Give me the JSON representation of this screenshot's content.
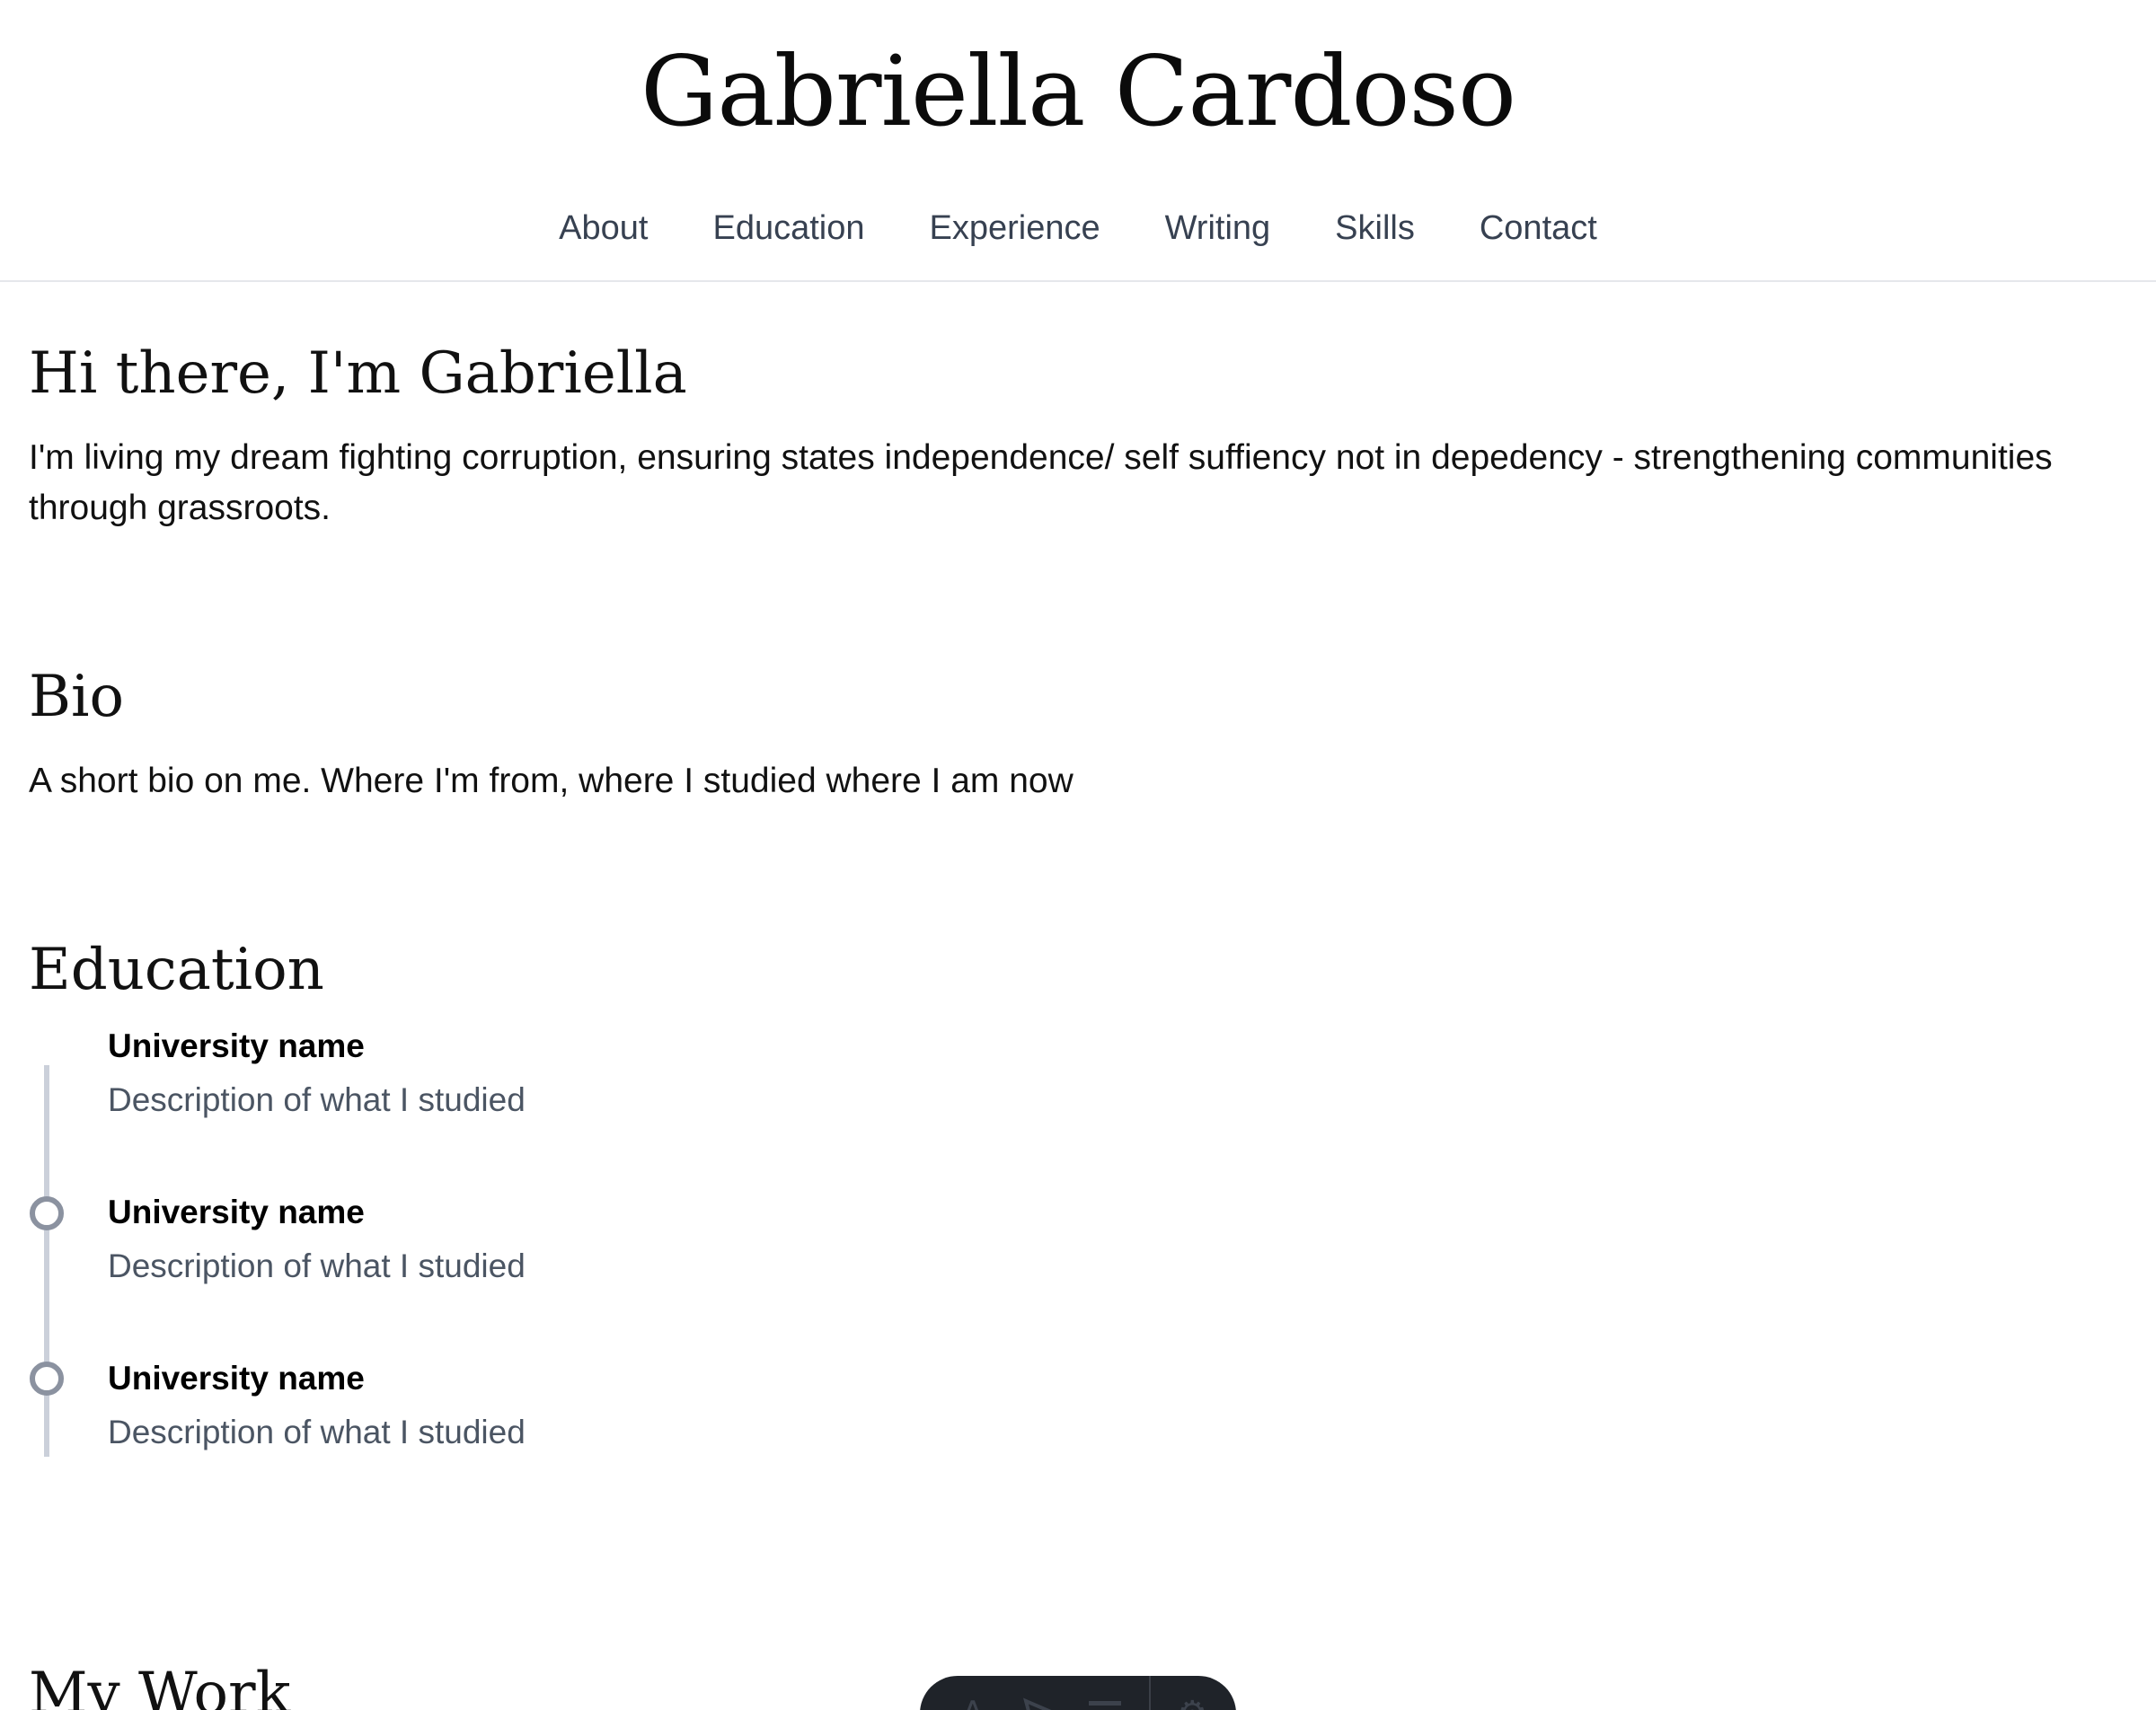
{
  "header": {
    "title": "Gabriella Cardoso",
    "nav": [
      "About",
      "Education",
      "Experience",
      "Writing",
      "Skills",
      "Contact"
    ]
  },
  "hero": {
    "heading": "Hi there, I'm Gabriella",
    "text": "I'm living my dream fighting corruption, ensuring states independence/ self suffiency not in depedency - strengthening communities through grassroots."
  },
  "bio": {
    "heading": "Bio",
    "text": "A short bio on me. Where I'm from, where I studied where I am now"
  },
  "education": {
    "heading": "Education",
    "items": [
      {
        "name": "University name",
        "description": "Description of what I studied"
      },
      {
        "name": "University name",
        "description": "Description of what I studied"
      },
      {
        "name": "University name",
        "description": "Description of what I studied"
      }
    ]
  },
  "work": {
    "heading": "My Work"
  },
  "toolbar": {
    "icons": [
      "text-style-icon",
      "pointer-icon",
      "menu-icon",
      "settings-icon"
    ]
  },
  "colors": {
    "nav_text": "#374151",
    "timeline_line": "#cbd0da",
    "timeline_dot": "#8b92a0",
    "description_text": "#4b5563",
    "toolbar_bg": "#1f2329",
    "divider": "#e5e7eb"
  }
}
